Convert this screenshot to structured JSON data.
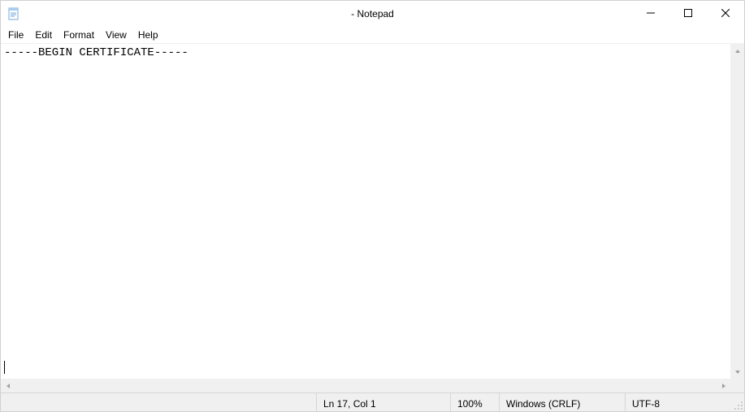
{
  "titlebar": {
    "title": " - Notepad"
  },
  "menu": {
    "items": [
      "File",
      "Edit",
      "Format",
      "View",
      "Help"
    ]
  },
  "editor": {
    "content": "-----BEGIN CERTIFICATE-----"
  },
  "status": {
    "position": "Ln 17, Col 1",
    "zoom": "100%",
    "line_ending": "Windows (CRLF)",
    "encoding": "UTF-8"
  },
  "icons": {
    "notepad": "notepad-icon",
    "minimize": "minimize-icon",
    "maximize": "maximize-icon",
    "close": "close-icon"
  }
}
